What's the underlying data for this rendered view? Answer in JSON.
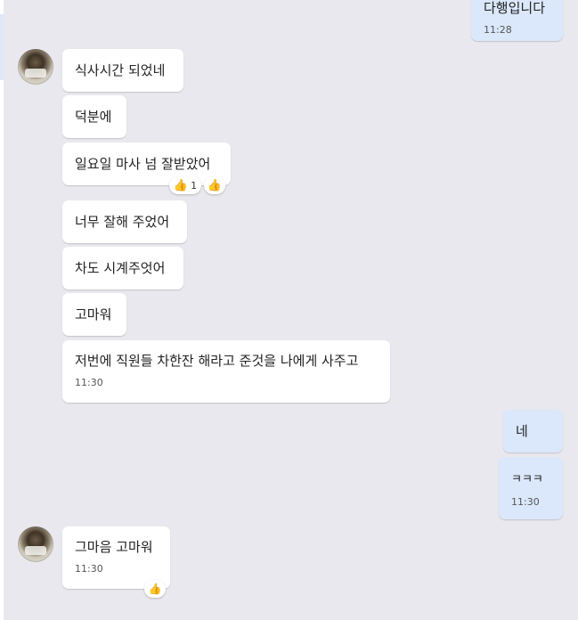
{
  "messages": [
    {
      "text": "다행입니다",
      "time": "11:28"
    },
    {
      "text": "식사시간 되었네"
    },
    {
      "text": "덕분에"
    },
    {
      "text": "일요일 마사 넘 잘받았어",
      "reaction_count": "1"
    },
    {
      "text": "너무 잘해 주었어"
    },
    {
      "text": "차도 시계주엇어"
    },
    {
      "text": "고마워"
    },
    {
      "text": "저번에 직원들 차한잔 해라고 준것을 나에게 사주고",
      "time": "11:30"
    },
    {
      "text": "네"
    },
    {
      "text": "ㅋㅋㅋ",
      "time": "11:30"
    },
    {
      "text": "그마음 고마워",
      "time": "11:30"
    }
  ],
  "icons": {
    "reaction_icon": "thumbs-up-emoji",
    "add_reaction_icon": "thumbs-up-outline"
  }
}
